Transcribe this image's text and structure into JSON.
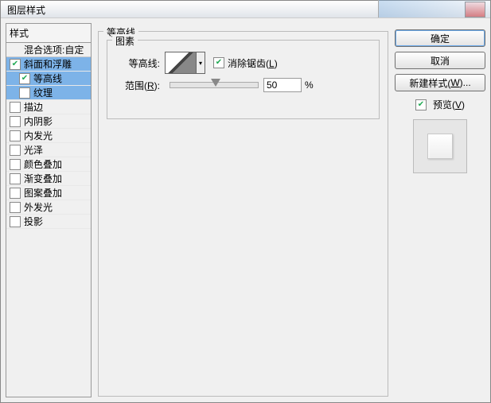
{
  "title": "图层样式",
  "left": {
    "header": "样式",
    "items": [
      {
        "label": "混合选项:自定",
        "checked": false,
        "default": true
      },
      {
        "label": "斜面和浮雕",
        "checked": true,
        "sel": true
      },
      {
        "label": "等高线",
        "checked": true,
        "sel": true,
        "sub": true
      },
      {
        "label": "纹理",
        "checked": false,
        "sel": true,
        "sub": true
      },
      {
        "label": "描边",
        "checked": false
      },
      {
        "label": "内阴影",
        "checked": false
      },
      {
        "label": "内发光",
        "checked": false
      },
      {
        "label": "光泽",
        "checked": false
      },
      {
        "label": "颜色叠加",
        "checked": false
      },
      {
        "label": "渐变叠加",
        "checked": false
      },
      {
        "label": "图案叠加",
        "checked": false
      },
      {
        "label": "外发光",
        "checked": false
      },
      {
        "label": "投影",
        "checked": false
      }
    ]
  },
  "center": {
    "group_title": "等高线",
    "sub_title": "图素",
    "contour_label": "等高线:",
    "antialias_checked": true,
    "antialias_label": "消除锯齿(",
    "antialias_mnemonic": "L",
    "antialias_tail": ")",
    "range_label": "范围(",
    "range_mnemonic": "R",
    "range_tail": "):",
    "range_value": "50",
    "range_unit": "%"
  },
  "right": {
    "ok": "确定",
    "cancel": "取消",
    "newstyle_pre": "新建样式(",
    "newstyle_m": "W",
    "newstyle_post": ")...",
    "preview_checked": true,
    "preview_label_pre": "预览(",
    "preview_m": "V",
    "preview_label_post": ")"
  }
}
